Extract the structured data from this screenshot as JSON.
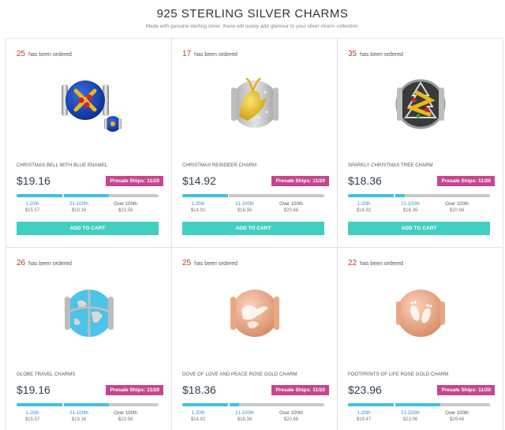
{
  "header": {
    "title": "925 STERLING SILVER CHARMS",
    "subtitle": "Made with genuine sterling silver, these will surely add glamour to your silver charm collection."
  },
  "common": {
    "ordered_suffix": "has been ordered",
    "add_to_cart": "ADD TO CART",
    "tier_labels": [
      "1-20th",
      "21-100th",
      "Over 100th"
    ]
  },
  "products": [
    {
      "ordered": "25",
      "name": "CHRISTMAS BELL WITH BLUE ENAMEL",
      "price": "$19.16",
      "presale": "Presale Ships: 11/20",
      "progress": 0.65,
      "tier_prices": [
        "$15.57",
        "$19.16",
        "$23.56"
      ],
      "icon": "blue-enamel-bell-charm"
    },
    {
      "ordered": "17",
      "name": "CHRISTMAS REINDEER CHARM",
      "price": "$14.92",
      "presale": "Presale Ships: 11/20",
      "progress": 0.33,
      "tier_prices": [
        "$14.92",
        "$18.36",
        "$20.66"
      ],
      "icon": "gold-reindeer-charm"
    },
    {
      "ordered": "35",
      "name": "SPARKLY CHRISTMAS TREE CHARM",
      "price": "$18.36",
      "presale": "Presale Ships: 11/20",
      "progress": 0.4,
      "tier_prices": [
        "$14.92",
        "$18.36",
        "$20.66"
      ],
      "icon": "christmas-tree-charm"
    },
    {
      "ordered": "26",
      "name": "GLOBE TRAVEL CHARMS",
      "price": "$19.16",
      "presale": "Presale Ships: 11/20",
      "progress": 0.65,
      "tier_prices": [
        "$15.57",
        "$19.16",
        "$23.56"
      ],
      "icon": "globe-travel-charm"
    },
    {
      "ordered": "25",
      "name": "DOVE OF LOVE AND PEACE ROSE GOLD CHARM",
      "price": "$18.36",
      "presale": "Presale Ships: 11/20",
      "progress": 0.4,
      "tier_prices": [
        "$14.92",
        "$18.36",
        "$20.66"
      ],
      "icon": "rose-gold-dove-charm"
    },
    {
      "ordered": "22",
      "name": "FOOTPRINTS OF LIFE ROSE GOLD CHARM",
      "price": "$23.96",
      "presale": "Presale Ships: 11/20",
      "progress": 0.65,
      "tier_prices": [
        "$19.47",
        "$23.96",
        "$29.46"
      ],
      "icon": "rose-gold-footprints-charm"
    }
  ]
}
